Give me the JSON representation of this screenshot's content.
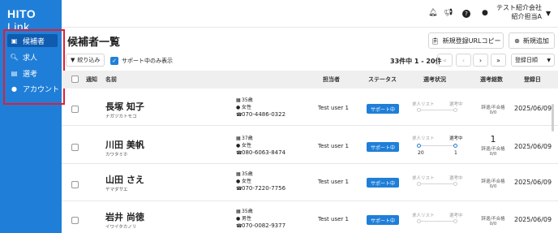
{
  "app": {
    "logo_bold": "HITO",
    "logo_light": " Link"
  },
  "sidebar": {
    "items": [
      {
        "label": "候補者",
        "icon": "candidate-icon"
      },
      {
        "label": "求人",
        "icon": "search-icon"
      },
      {
        "label": "選考",
        "icon": "selection-icon"
      },
      {
        "label": "アカウント",
        "icon": "person-icon"
      }
    ],
    "active_index": 0,
    "highlight_color": "#e01e37"
  },
  "header": {
    "user_company": "テスト紹介会社",
    "user_name": "紹介担当A"
  },
  "page": {
    "title": "候補者一覧",
    "copy_button": "新規登録URLコピー",
    "add_button": "新規追加"
  },
  "toolbar": {
    "filter_label": "絞り込み",
    "support_only_label": "サポート中のみ表示",
    "support_only_checked": true,
    "count_label": "33件中 1 - 20件",
    "first_label": "«",
    "prev_label": "‹",
    "next_label": "›",
    "last_label": "»",
    "sort_label": "登録日順"
  },
  "table": {
    "headers": {
      "notice": "通知",
      "name": "名前",
      "owner": "担当者",
      "status": "ステータス",
      "selection": "選考状況",
      "total": "選考総数",
      "registered": "登録日"
    },
    "rows": [
      {
        "name": "長塚 知子",
        "kana": "ナガツカトモコ",
        "age": "35歳",
        "gender": "女性",
        "phone": "070-4486-0322",
        "owner": "Test user 1",
        "status": "サポート中",
        "sel_left": "求人リスト",
        "sel_right": "選考中",
        "sel_left_count": "",
        "sel_right_count": "",
        "total": "",
        "total_label": "辞退/不合格\n0/0",
        "date": "2025/06/09"
      },
      {
        "name": "川田 美帆",
        "kana": "カワタミホ",
        "age": "37歳",
        "gender": "女性",
        "phone": "080-6063-8474",
        "owner": "Test user 1",
        "status": "サポート中",
        "sel_left": "求人リスト",
        "sel_right": "選考中",
        "sel_left_count": "20",
        "sel_right_count": "1",
        "total": "1",
        "total_label": "辞退/不合格\n0/0",
        "date": "2025/06/09"
      },
      {
        "name": "山田 さえ",
        "kana": "ヤマダサエ",
        "age": "35歳",
        "gender": "女性",
        "phone": "070-7220-7756",
        "owner": "Test user 1",
        "status": "サポート中",
        "sel_left": "求人リスト",
        "sel_right": "選考中",
        "sel_left_count": "",
        "sel_right_count": "",
        "total": "",
        "total_label": "辞退/不合格\n0/0",
        "date": "2025/06/09"
      },
      {
        "name": "岩井 尚徳",
        "kana": "イワイタカノリ",
        "age": "35歳",
        "gender": "男性",
        "phone": "070-0082-9377",
        "owner": "Test user 1",
        "status": "サポート中",
        "sel_left": "求人リスト",
        "sel_right": "選考中",
        "sel_left_count": "",
        "sel_right_count": "",
        "total": "",
        "total_label": "辞退/不合格\n0/0",
        "date": "2025/06/09"
      }
    ]
  },
  "colors": {
    "brand": "#1f7fd8",
    "sidebar_active": "#0e5bb0",
    "status_bg": "#1f7fd8"
  }
}
